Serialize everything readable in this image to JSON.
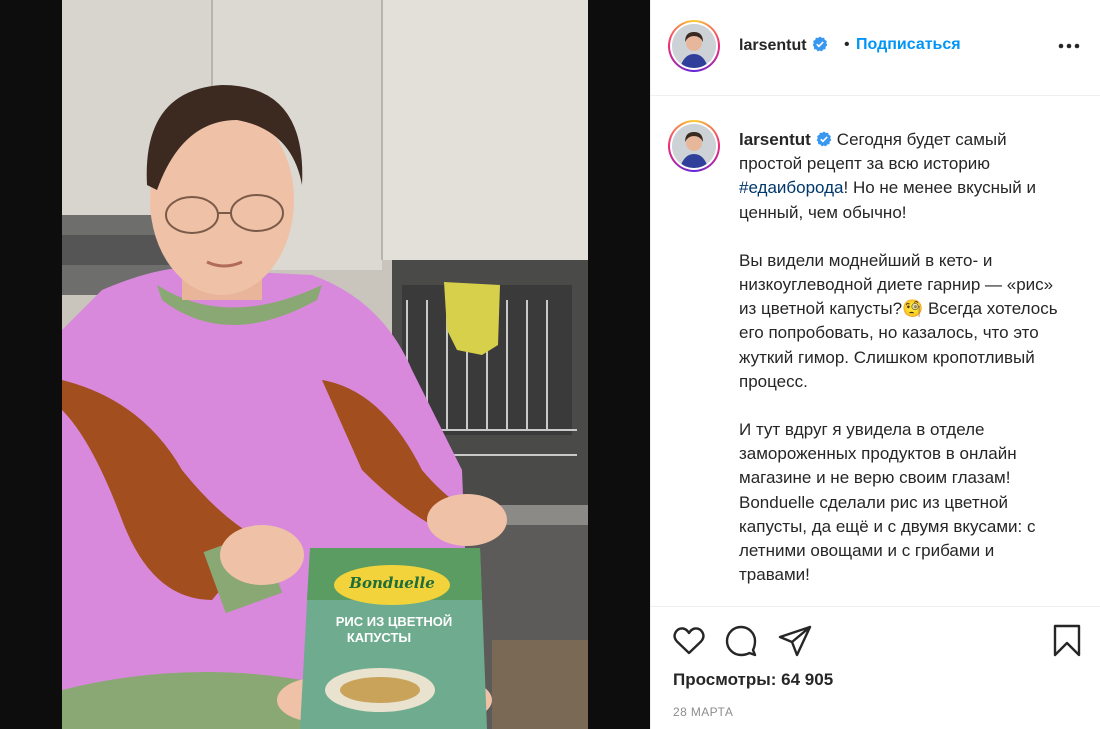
{
  "post": {
    "username": "larsentut",
    "follow_separator": "•",
    "follow_label": "Подписаться",
    "caption": {
      "username": "larsentut",
      "p1_before": "Сегодня будет самый простой рецепт за всю историю ",
      "hashtag": "#едаиборода",
      "p1_after": "! Но не менее вкусный и ценный, чем обычно!",
      "p2": "Вы видели моднейший в кето- и низкоуглеводной диете гарнир — «рис» из цветной капусты?🧐 Всегда хотелось его попробовать, но казалось, что это жуткий гимор. Слишком кропотливый процесс.",
      "p3": "И тут вдруг я увидела в отделе замороженных продуктов в онлайн магазине и не верю своим глазам! Bonduelle сделали рис из цветной капусты, да ещё и с двумя вкусами: с летними овощами и с грибами и травами!"
    },
    "views_label": "Просмотры:",
    "views_count": "64 905",
    "date": "28 МАРТА"
  },
  "product": {
    "brand": "Bonduelle",
    "name_line1": "РИС ИЗ ЦВЕТНОЙ",
    "name_line2": "КАПУСТЫ"
  },
  "icons": {
    "verified": "verified-badge-icon",
    "more": "more-options-icon",
    "like": "heart-icon",
    "comment": "comment-icon",
    "share": "paper-plane-icon",
    "save": "bookmark-icon"
  },
  "colors": {
    "accent": "#0095f6",
    "hashtag": "#00376b",
    "verified": "#3897f0",
    "muted": "#8e8e8e"
  }
}
